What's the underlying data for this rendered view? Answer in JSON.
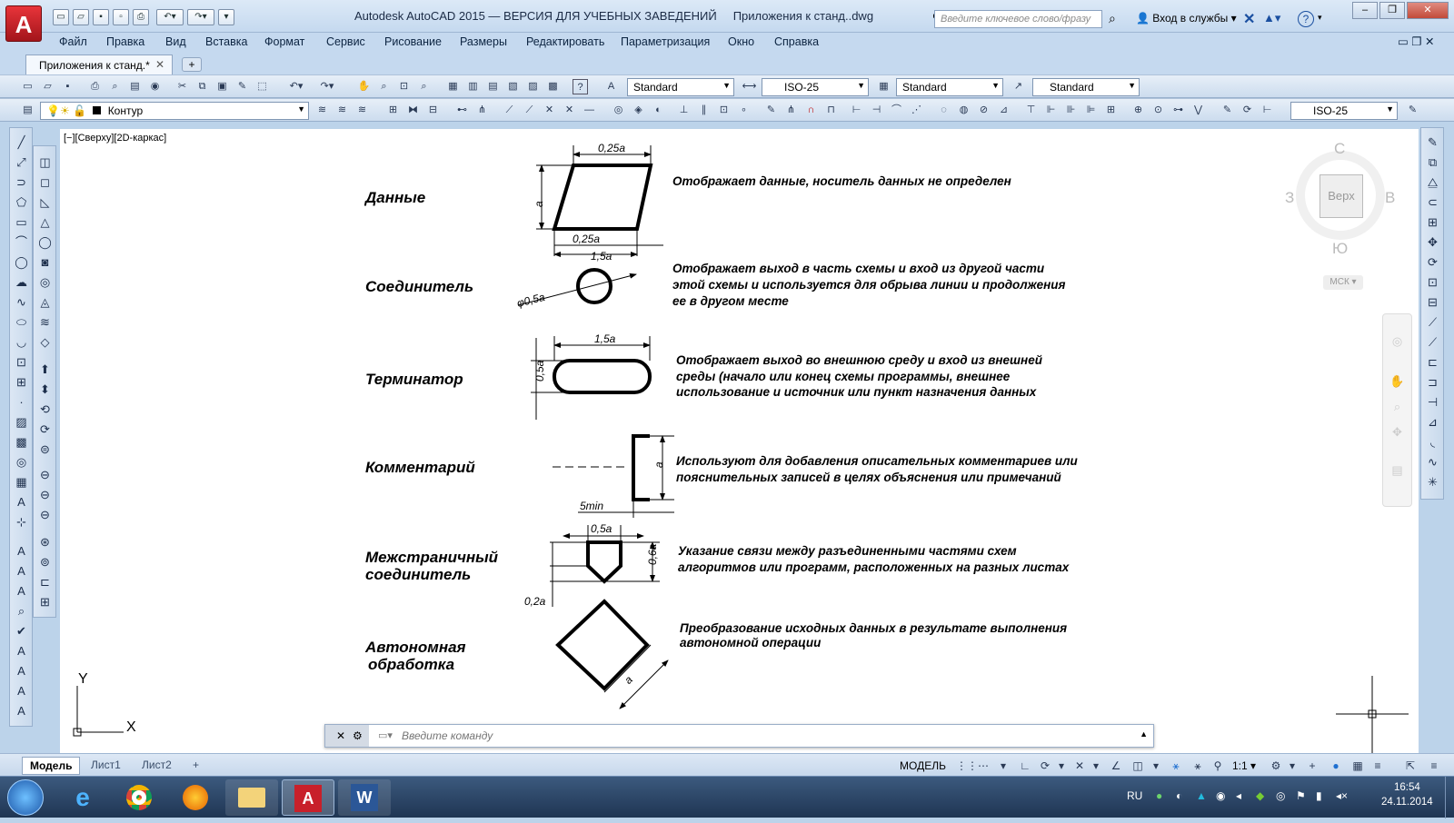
{
  "window": {
    "title": "Autodesk AutoCAD 2015 — ВЕРСИЯ ДЛЯ УЧЕБНЫХ ЗАВЕДЕНИЙ",
    "document": "Приложения к станд..dwg"
  },
  "app_logo": "A",
  "search": {
    "placeholder": "Введите ключевое слово/фразу"
  },
  "signin": "Вход в службы",
  "help": "?",
  "menu": [
    "Файл",
    "Правка",
    "Вид",
    "Вставка",
    "Формат",
    "Сервис",
    "Рисование",
    "Размеры",
    "Редактировать",
    "Параметризация",
    "Окно",
    "Справка"
  ],
  "doc_tab": "Приложения к станд.*",
  "styles": {
    "text": "Standard",
    "dim": "ISO-25",
    "table": "Standard",
    "mleader": "Standard"
  },
  "layer": {
    "name": "Контур",
    "dimstyle": "ISO-25"
  },
  "viewport_label": "[−][Сверху][2D-каркас]",
  "viewcube": {
    "north": "С",
    "south": "Ю",
    "west": "З",
    "east": "В",
    "face": "Верх",
    "ucs": "МСК"
  },
  "ucs_icon": {
    "y": "Y",
    "x": "X"
  },
  "drawing": {
    "rows": [
      {
        "name": [
          "Данные"
        ],
        "desc": [
          "Отображает данные, носитель данных не определен"
        ]
      },
      {
        "name": [
          "Соединитель"
        ],
        "desc": [
          "Отображает выход в часть схемы и вход из другой части",
          "этой схемы и используется для обрыва линии и продолжения",
          "ее в другом месте"
        ]
      },
      {
        "name": [
          "Терминатор"
        ],
        "desc": [
          "Отображает выход во внешнюю среду и вход из внешней",
          "среды (начало или конец схемы программы, внешнее",
          "использование и источник или пункт назначения данных"
        ]
      },
      {
        "name": [
          "Комментарий"
        ],
        "desc": [
          "Используют для добавления описательных комментариев или",
          "пояснительных записей в целях объяснения или примечаний"
        ]
      },
      {
        "name": [
          "Межстраничный",
          "соединитель"
        ],
        "desc": [
          "Указание связи между разъединенными частями схем",
          "алгоритмов или программ, расположенных на разных листах"
        ]
      },
      {
        "name": [
          "Автономная",
          "обработка"
        ],
        "desc": [
          "Преобразование исходных данных в результате выполнения",
          "автономной операции"
        ]
      }
    ],
    "dims": {
      "d1": "0,25a",
      "d2": "a",
      "d3": "0,25a",
      "d4": "1,5a",
      "d5": "φ0,5a",
      "d6": "1,5a",
      "d7": "0,5a",
      "d8": "a",
      "d9": "5min",
      "d10": "0,5a",
      "d11": "0,6a",
      "d12": "0,2a",
      "d13": "a"
    }
  },
  "command": {
    "placeholder": "Введите команду"
  },
  "layouts": [
    "Модель",
    "Лист1",
    "Лист2"
  ],
  "status": {
    "mode": "МОДЕЛЬ",
    "scale": "1:1"
  },
  "tray": {
    "lang": "RU",
    "time": "16:54",
    "date": "24.11.2014"
  }
}
